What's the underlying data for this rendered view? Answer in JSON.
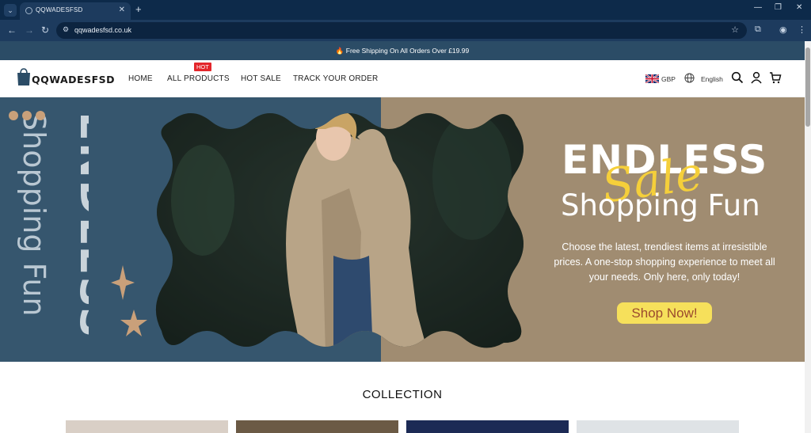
{
  "browser": {
    "tab_title": "QQWADESFSD",
    "url": "qqwadesfsd.co.uk"
  },
  "announcement": {
    "icon": "fire-icon",
    "text": "Free Shipping On All Orders Over £19.99"
  },
  "header": {
    "logo_text": "QQWADESFSD",
    "nav": [
      {
        "label": "HOME"
      },
      {
        "label": "ALL PRODUCTS",
        "badge": "HOT"
      },
      {
        "label": "HOT SALE"
      },
      {
        "label": "TRACK YOUR ORDER"
      }
    ],
    "currency": "GBP",
    "language": "English",
    "colors": {
      "badge": "#e3262b"
    }
  },
  "hero": {
    "vertical_title": "ENDLESS",
    "vertical_sub": "Shopping Fun",
    "title": "ENDLESS",
    "sale_script": "Sale",
    "subtitle": "Shopping Fun",
    "description": "Choose the latest, trendiest items at irresistible prices. A one-stop shopping experience to meet all your needs. Only here, only today!",
    "cta": "Shop Now!",
    "colors": {
      "left_bg": "#36566e",
      "right_bg": "#a08c71",
      "cta_bg": "#f6e05b",
      "script": "#f5cf3a"
    }
  },
  "collection": {
    "heading": "COLLECTION"
  }
}
